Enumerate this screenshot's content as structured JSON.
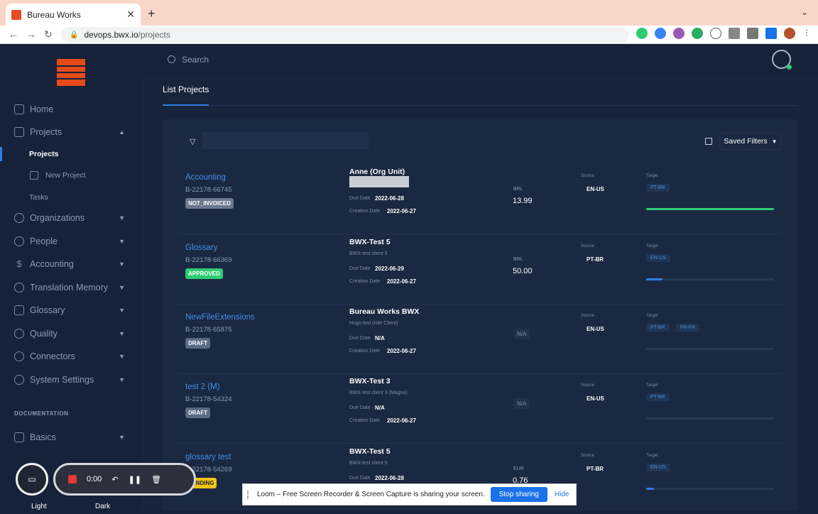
{
  "browser": {
    "tab_title": "Bureau Works",
    "url_domain": "devops.bwx.io",
    "url_path": "/projects"
  },
  "sidebar": {
    "items": [
      {
        "label": "Home"
      },
      {
        "label": "Projects"
      },
      {
        "label": "Organizations"
      },
      {
        "label": "People"
      },
      {
        "label": "Accounting"
      },
      {
        "label": "Translation Memory"
      },
      {
        "label": "Glossary"
      },
      {
        "label": "Quality"
      },
      {
        "label": "Connectors"
      },
      {
        "label": "System Settings"
      }
    ],
    "sub_items": [
      "Projects",
      "New Project",
      "Tasks"
    ],
    "doc_header": "DOCUMENTATION",
    "doc_items": [
      {
        "label": "Basics"
      }
    ],
    "theme_light": "Light",
    "theme_dark": "Dark"
  },
  "topbar": {
    "search_label": "Search"
  },
  "main": {
    "page_title": "List Projects",
    "saved_filters": "Saved Filters",
    "labels": {
      "due": "Due Date",
      "creation": "Creation Date",
      "source": "Source",
      "target": "Target"
    }
  },
  "projects": [
    {
      "name": "Accounting",
      "code": "B-22178-66745",
      "status": "NOT_INVOICED",
      "client": "Anne (Org Unit)",
      "client_sub": "",
      "due": "2022-06-28",
      "created": "2022-06-27",
      "currency": "BRL",
      "amount": "13.99",
      "source": "EN-US",
      "targets": [
        "PT-BR"
      ],
      "progress": 1.0
    },
    {
      "name": "Glossary",
      "code": "B-22178-66369",
      "status": "APPROVED",
      "client": "BWX-Test 5",
      "client_sub": "BWX-test client 5",
      "due": "2022-06-29",
      "created": "2022-06-27",
      "currency": "BRL",
      "amount": "50.00",
      "source": "PT-BR",
      "targets": [
        "EN-US"
      ],
      "progress": 0.13
    },
    {
      "name": "NewFileExtensions",
      "code": "B-22178-65875",
      "status": "DRAFT",
      "client": "Bureau Works BWX",
      "client_sub": "Hugo-test (role Client)",
      "due": "N/A",
      "created": "2022-06-27",
      "currency": "",
      "amount": "N/A",
      "source": "EN-US",
      "targets": [
        "PT-BR",
        "FR-FR"
      ],
      "progress": 0
    },
    {
      "name": "test 2 (M)",
      "code": "B-22178-54324",
      "status": "DRAFT",
      "client": "BWX-Test 3",
      "client_sub": "BWX-test client 3 (Magno)",
      "due": "N/A",
      "created": "2022-06-27",
      "currency": "",
      "amount": "N/A",
      "source": "EN-US",
      "targets": [
        "PT-BR"
      ],
      "progress": 0
    },
    {
      "name": "glossary test",
      "code": "B-22178-54269",
      "status": "PENDING",
      "client": "BWX-Test 5",
      "client_sub": "BWX-test client 5",
      "due": "2022-06-28",
      "created": "",
      "currency": "EUR",
      "amount": "0.76",
      "source": "PT-BR",
      "targets": [
        "EN-US"
      ],
      "progress": 0.06
    }
  ],
  "loom": {
    "timer": "0:00",
    "share_message": "Loom – Free Screen Recorder & Screen Capture is sharing your screen.",
    "stop_label": "Stop sharing",
    "hide_label": "Hide"
  }
}
